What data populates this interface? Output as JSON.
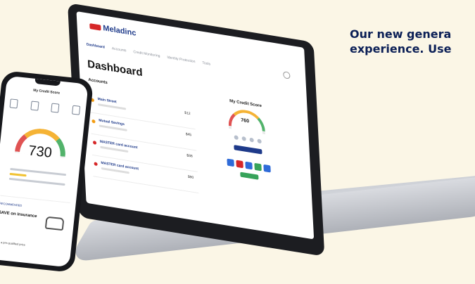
{
  "headline": {
    "line1": "Our new genera",
    "line2": "experience. Use"
  },
  "laptop": {
    "brand": "Meladinc",
    "nav": [
      "Dashboard",
      "Accounts",
      "Credit Monitoring",
      "Identity Protection",
      "Tools"
    ],
    "page_title": "Dashboard",
    "accounts_label": "Accounts",
    "accounts": [
      {
        "name": "Main Street",
        "value": "$12"
      },
      {
        "name": "Mutual Savings",
        "value": "$45"
      },
      {
        "name": "MASTER card account",
        "value": "$88"
      },
      {
        "name": "MASTER card account",
        "value": "$90"
      }
    ],
    "credit_card_title": "My Credit Score",
    "credit_mini_score": "760"
  },
  "phone": {
    "title": "My Credit Score",
    "score": "730",
    "card_link": "RECOMMENDED",
    "card_title": "SAVE on insurance",
    "footer": "Get a pre-qualified price"
  },
  "colors": {
    "background": "#fbf6e6",
    "headline": "#0b1f56",
    "brand_blue": "#1e3a8a",
    "gauge_red": "#e05353",
    "gauge_yellow": "#f5b335",
    "gauge_green": "#52b36b"
  }
}
